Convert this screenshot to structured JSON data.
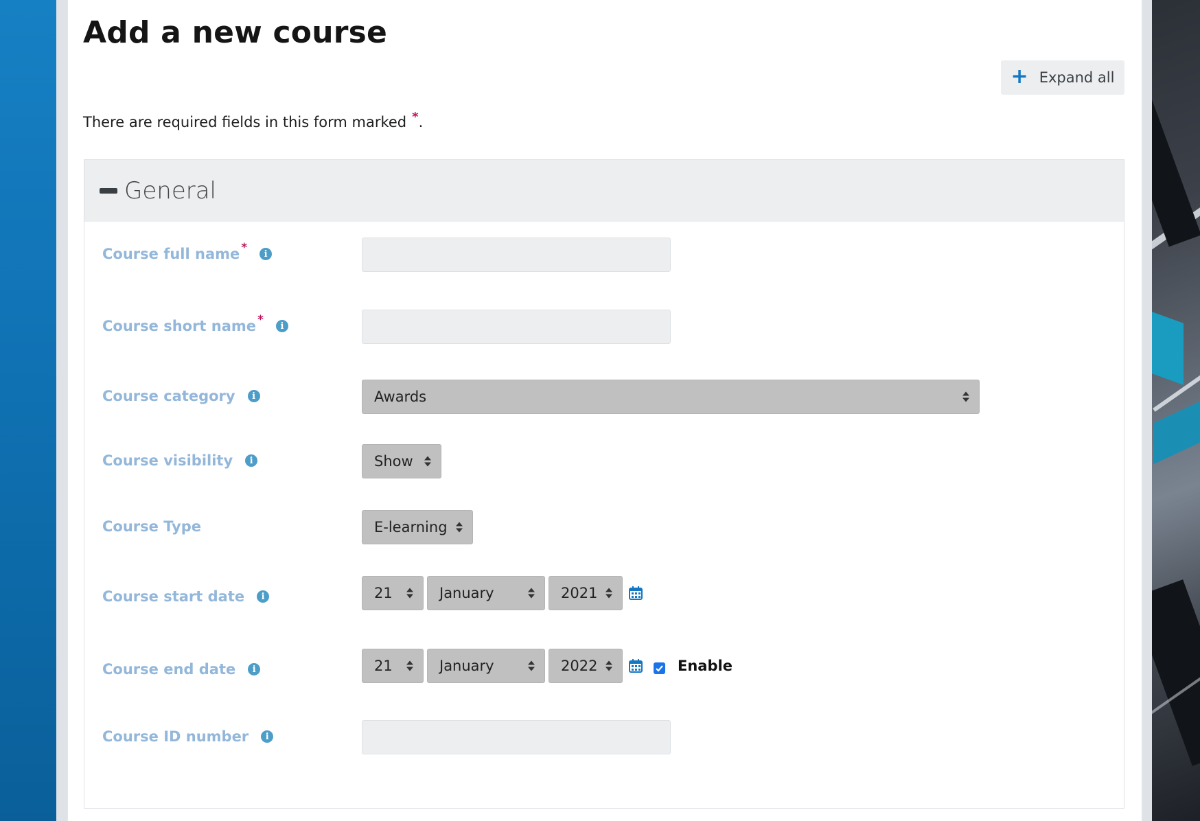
{
  "page": {
    "title": "Add a new course",
    "expand_all_label": "Expand all",
    "required_note": "There are required fields in this form marked",
    "required_note_end": "."
  },
  "section": {
    "title": "General"
  },
  "fields": {
    "full_name": {
      "label": "Course full name",
      "value": ""
    },
    "short_name": {
      "label": "Course short name",
      "value": ""
    },
    "category": {
      "label": "Course category",
      "selected": "Awards"
    },
    "visibility": {
      "label": "Course visibility",
      "selected": "Show"
    },
    "type": {
      "label": "Course Type",
      "selected": "E-learning"
    },
    "start_date": {
      "label": "Course start date",
      "day": "21",
      "month": "January",
      "year": "2021"
    },
    "end_date": {
      "label": "Course end date",
      "day": "21",
      "month": "January",
      "year": "2022",
      "enable_label": "Enable",
      "enabled": true
    },
    "id_number": {
      "label": "Course ID number",
      "value": ""
    }
  },
  "colors": {
    "accent": "#1577c2",
    "label": "#93b7da",
    "required": "#b8155a"
  }
}
